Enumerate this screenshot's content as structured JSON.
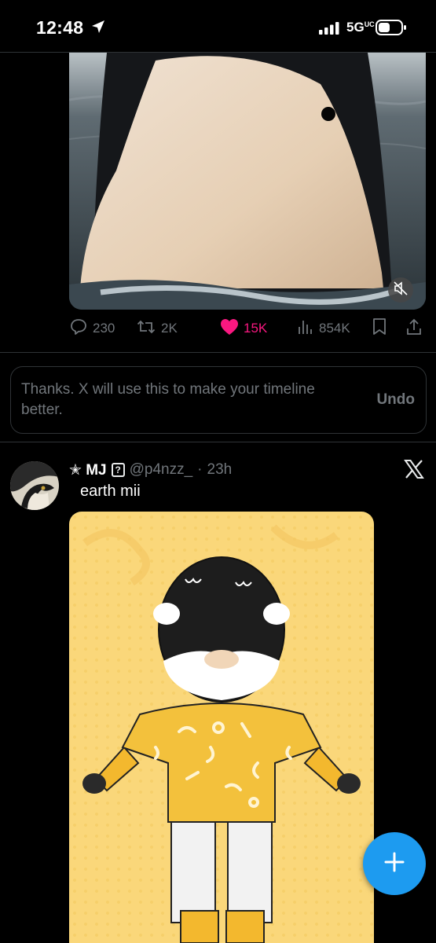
{
  "status_bar": {
    "time": "12:48",
    "network": "5G",
    "network_suffix": "UC"
  },
  "post1": {
    "media_alt": "orca whale surfacing",
    "actions": {
      "replies": "230",
      "reposts": "2K",
      "likes": "15K",
      "views": "854K"
    },
    "liked": true
  },
  "feedback": {
    "message": "Thanks. X will use this to make your timeline better.",
    "undo_label": "Undo"
  },
  "post2": {
    "name_prefix": "✭",
    "name": "MJ",
    "name_badge": "?",
    "handle": "@p4nzz_",
    "separator": "·",
    "time": "23h",
    "text": "earth mii"
  },
  "colors": {
    "background": "#000000",
    "muted_text": "#71767b",
    "like_pink": "#f91880",
    "accent_blue": "#1d9bf0",
    "mii_background": "#fad77a"
  },
  "icons": [
    "location-arrow-icon",
    "signal-icon",
    "battery-icon",
    "mute-icon",
    "reply-icon",
    "repost-icon",
    "heart-icon",
    "views-icon",
    "bookmark-icon",
    "share-icon",
    "x-logo-icon",
    "plus-icon"
  ]
}
